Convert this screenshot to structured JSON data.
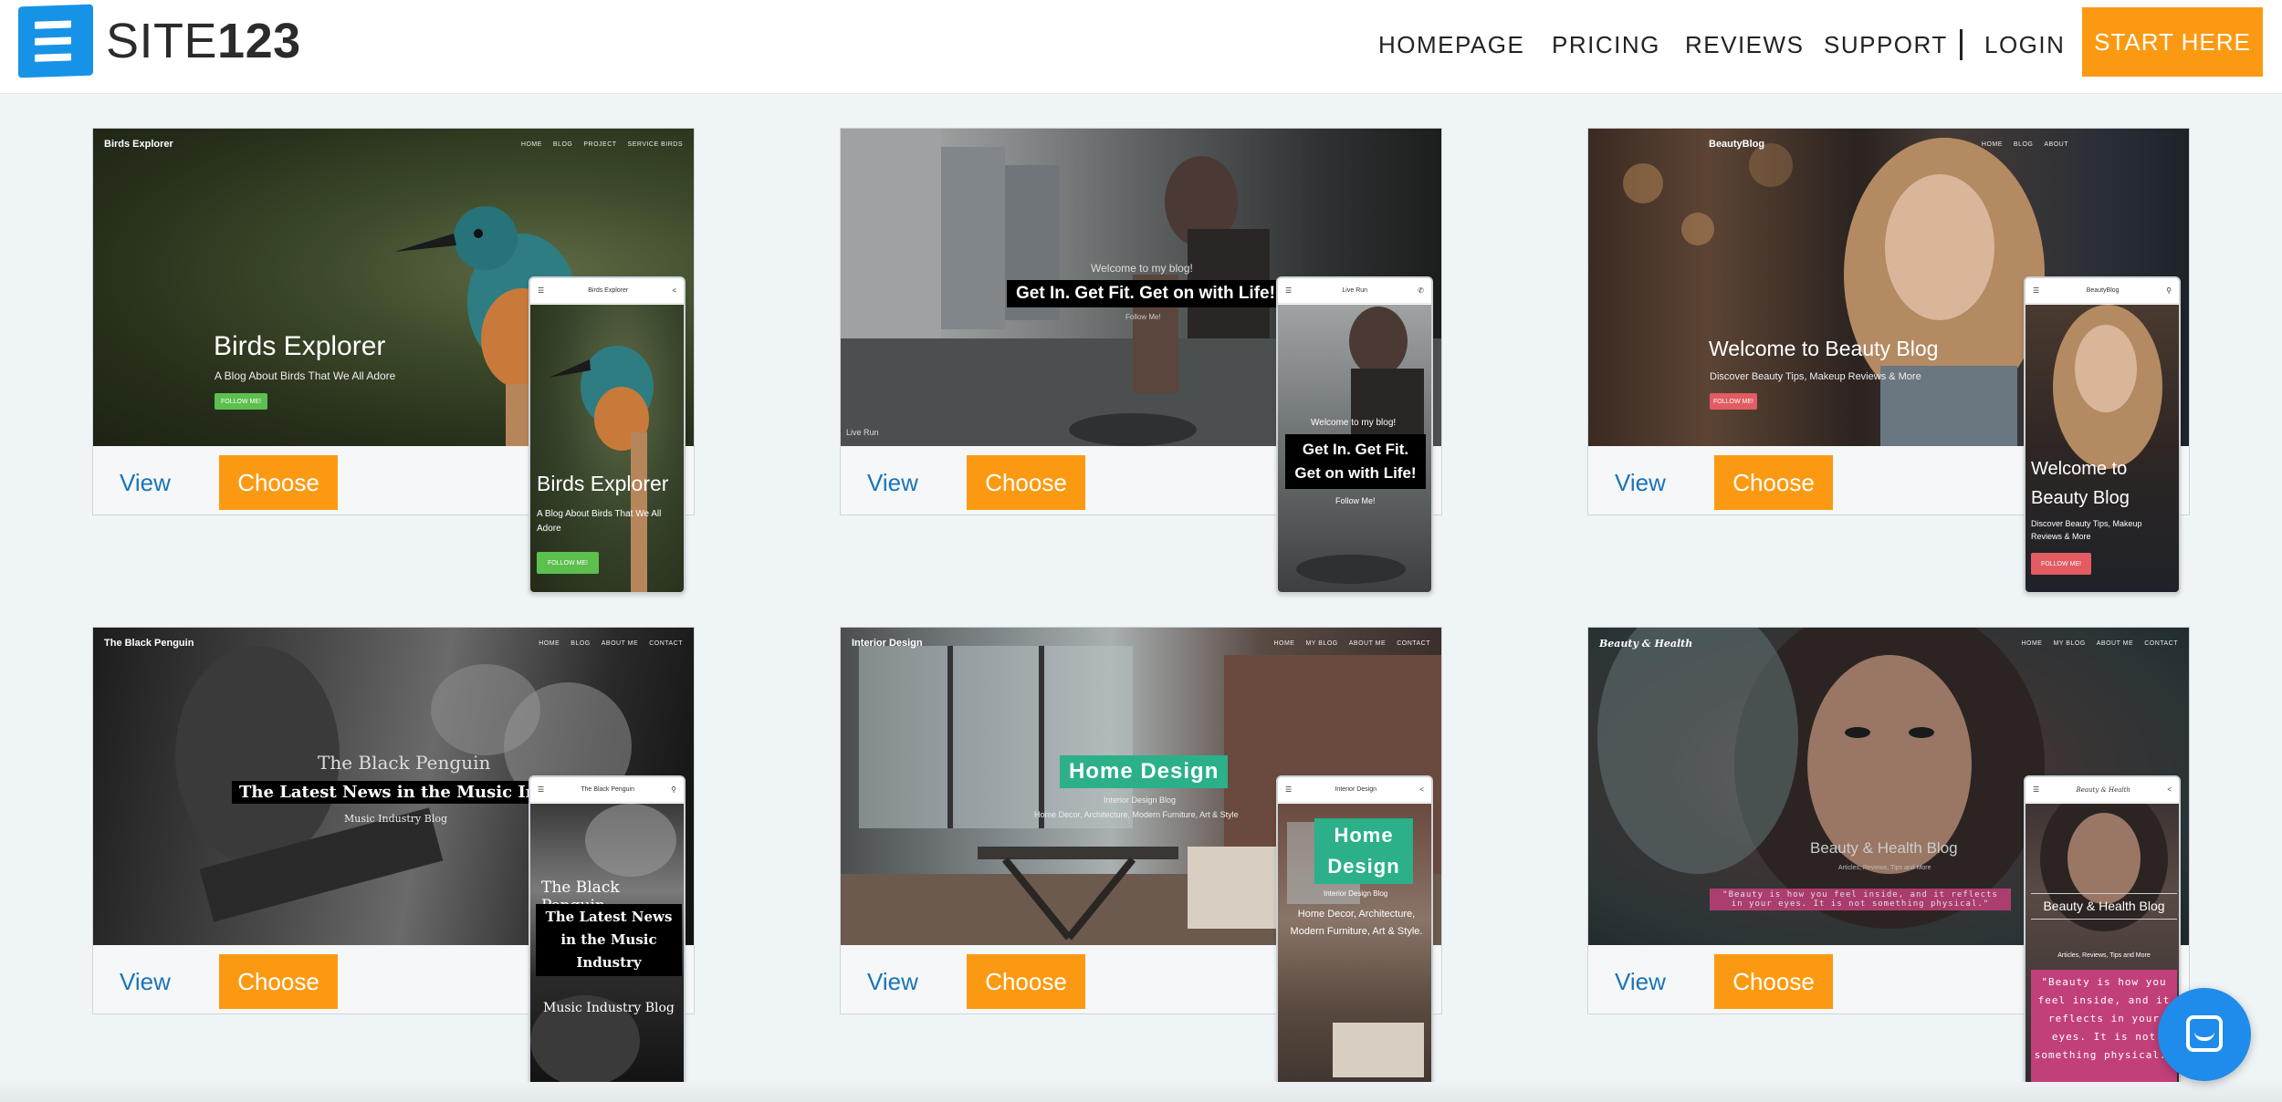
{
  "brand": {
    "logo_text_light": "SITE",
    "logo_text_bold": "123"
  },
  "nav": {
    "items": [
      "HOMEPAGE",
      "PRICING",
      "REVIEWS",
      "SUPPORT",
      "LOGIN"
    ],
    "cta": "START HERE"
  },
  "card_actions": {
    "view": "View",
    "choose": "Choose"
  },
  "templates": [
    {
      "name": "Birds Explorer",
      "nav_links": [
        "HOME",
        "BLOG",
        "PROJECT",
        "SERVICE BIRDS"
      ],
      "title": "Birds Explorer",
      "subtitle": "A Blog About Birds That We All Adore",
      "button": "FOLLOW ME!",
      "mobile_title": "Birds Explorer",
      "mobile_subtitle": "A Blog About Birds That We All Adore",
      "mobile_button": "FOLLOW ME!",
      "accent": "#5cbf4e"
    },
    {
      "name": "Live Run",
      "nav_links": [],
      "kicker": "Welcome to my blog!",
      "title": "Get In. Get Fit. Get on with Life!",
      "subtitle": "Follow Me!",
      "footer": "Live Run",
      "mobile_kicker": "Welcome to my blog!",
      "mobile_title": "Get In. Get Fit. Get on with Life!",
      "mobile_button": "Follow Me!"
    },
    {
      "name": "BeautyBlog",
      "nav_links": [
        "HOME",
        "BLOG",
        "ABOUT"
      ],
      "title": "Welcome to Beauty Blog",
      "subtitle": "Discover Beauty Tips, Makeup Reviews & More",
      "button": "FOLLOW ME!",
      "mobile_title": "Welcome to Beauty Blog",
      "mobile_subtitle": "Discover Beauty Tips, Makeup Reviews & More",
      "mobile_button": "FOLLOW ME!",
      "accent": "#e25c62"
    },
    {
      "name": "The Black Penguin",
      "nav_links": [
        "HOME",
        "BLOG",
        "ABOUT ME",
        "CONTACT"
      ],
      "title": "The Black Penguin",
      "headline": "The Latest News in the Music Industry",
      "subtitle": "Music Industry Blog",
      "mobile_title": "The Black Penguin",
      "mobile_headline": "The Latest News in the Music Industry",
      "mobile_subtitle": "Music Industry Blog"
    },
    {
      "name": "Interior Design",
      "nav_links": [
        "HOME",
        "MY BLOG",
        "ABOUT ME",
        "CONTACT"
      ],
      "title": "Home Design",
      "subtitle": "Interior Design Blog",
      "body": "Home Decor, Architecture, Modern Furniture, Art & Style",
      "mobile_title": "Home Design",
      "mobile_subtitle": "Interior Design Blog",
      "mobile_body": "Home Decor, Architecture, Modern Furniture, Art & Style.",
      "accent": "#2bb08a"
    },
    {
      "name": "Beauty & Health",
      "nav_links": [
        "HOME",
        "MY BLOG",
        "ABOUT ME",
        "CONTACT"
      ],
      "title": "Beauty & Health Blog",
      "subtitle": "Articles, Reviews, Tips and More",
      "quote": "\"Beauty is how you feel inside, and it reflects in your eyes. It is not something physical.\"",
      "mobile_title": "Beauty & Health Blog",
      "mobile_subtitle": "Articles, Reviews, Tips and More",
      "mobile_quote": "\"Beauty is how you feel inside, and it reflects in your eyes. It is not something physical.\"",
      "accent": "#c2407a"
    }
  ]
}
